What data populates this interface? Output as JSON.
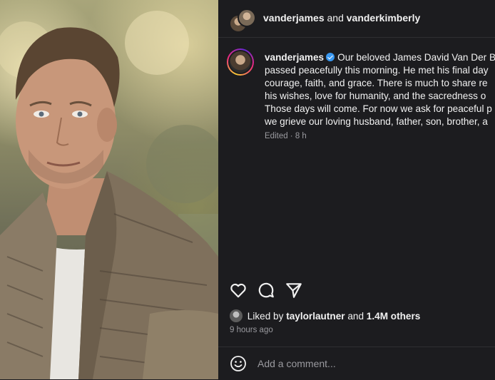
{
  "header": {
    "user1": "vanderjames",
    "and_text": "and",
    "user2": "vanderkimberly"
  },
  "post": {
    "username": "vanderjames",
    "verified_icon": "verified-badge-icon",
    "caption_lines": [
      "Our beloved James David Van Der B",
      "passed peacefully this morning. He met his final day",
      "courage, faith, and grace. There is much to share re",
      "his wishes, love for humanity, and the sacredness o",
      "Those days will come. For now we ask for peaceful p",
      "we grieve our loving husband, father, son, brother, a"
    ],
    "meta": "Edited · 8 h"
  },
  "actions": {
    "icons": [
      "heart-icon",
      "comment-icon",
      "share-icon"
    ]
  },
  "likes": {
    "prefix": "Liked by",
    "user": "taylorlautner",
    "and_text": "and",
    "count": "1.4M others"
  },
  "time_ago": "9 hours ago",
  "comment": {
    "placeholder": "Add a comment..."
  },
  "colors": {
    "background": "#1c1c1f",
    "text": "#f1f1f1",
    "muted": "#9a9a9f",
    "verified": "#3897f0"
  }
}
